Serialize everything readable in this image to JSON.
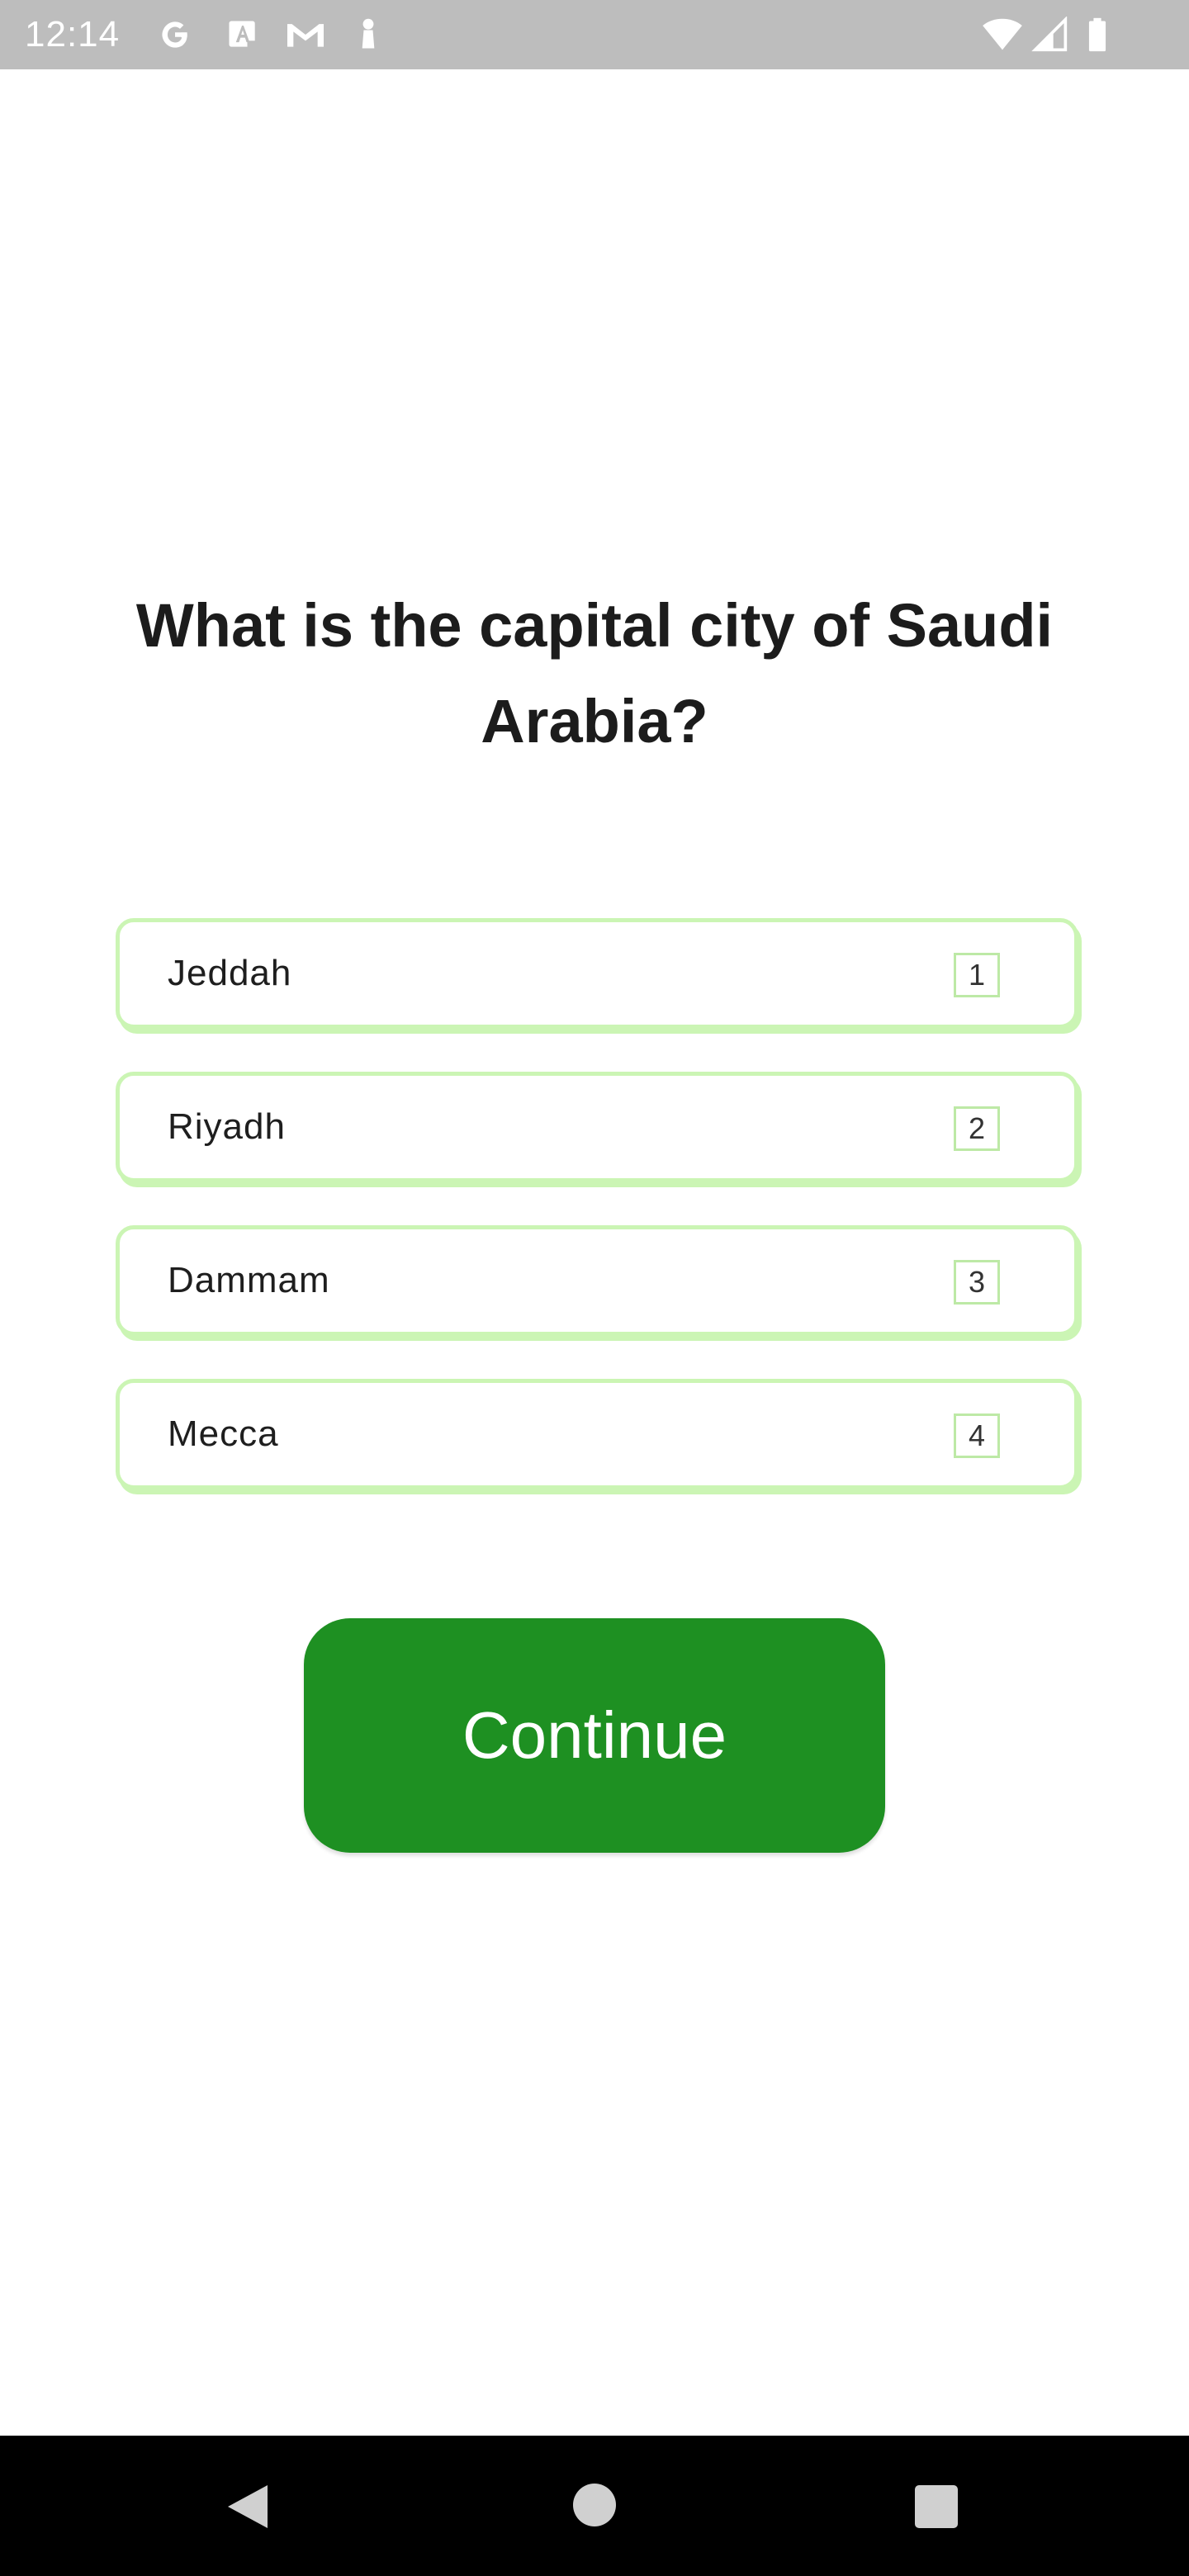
{
  "status_bar": {
    "time": "12:14",
    "left_icons": [
      "google-g-icon",
      "font-a-icon",
      "gmail-icon",
      "chess-pawn-icon"
    ],
    "right_icons": [
      "wifi-icon",
      "cellular-signal-icon",
      "battery-icon"
    ]
  },
  "question": {
    "text": "What is the capital city of Saudi Arabia?"
  },
  "options": [
    {
      "label": "Jeddah",
      "key": "1"
    },
    {
      "label": "Riyadh",
      "key": "2"
    },
    {
      "label": "Dammam",
      "key": "3"
    },
    {
      "label": "Mecca",
      "key": "4"
    }
  ],
  "continue_button": {
    "label": "Continue"
  },
  "colors": {
    "accent_green": "#1e9022",
    "option_border": "#cbf5b4",
    "status_bar": "#bdbdbd",
    "nav_bar": "#000000"
  },
  "nav_bar": {
    "icons": [
      "back-icon",
      "home-icon",
      "recents-icon"
    ]
  }
}
